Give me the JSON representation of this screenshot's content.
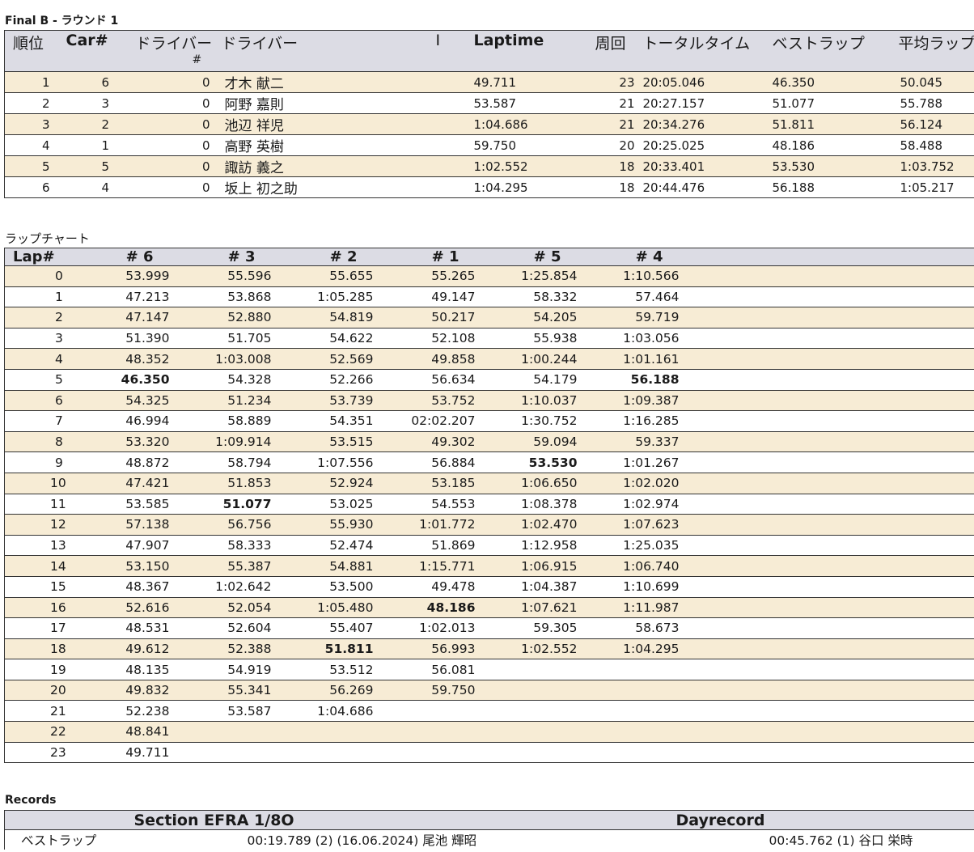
{
  "results_title": "Final B - ラウンド 1",
  "results": {
    "headers": {
      "pos": "順位",
      "car": "Car#",
      "driver_num": "ドライバー",
      "driver_num_sub": "#",
      "driver": "ドライバー",
      "sep": "I",
      "laptime": "Laptime",
      "laps": "周回",
      "total": "トータルタイム",
      "best": "ベストラップ",
      "avg": "平均ラップ"
    },
    "rows": [
      {
        "pos": "1",
        "car": "6",
        "dnum": "0",
        "driver": "才木 献二",
        "laptime": "49.711",
        "laps": "23",
        "total": "20:05.046",
        "best": "46.350",
        "avg": "50.045"
      },
      {
        "pos": "2",
        "car": "3",
        "dnum": "0",
        "driver": "阿野 嘉則",
        "laptime": "53.587",
        "laps": "21",
        "total": "20:27.157",
        "best": "51.077",
        "avg": "55.788"
      },
      {
        "pos": "3",
        "car": "2",
        "dnum": "0",
        "driver": "池辺 祥児",
        "laptime": "1:04.686",
        "laps": "21",
        "total": "20:34.276",
        "best": "51.811",
        "avg": "56.124"
      },
      {
        "pos": "4",
        "car": "1",
        "dnum": "0",
        "driver": "高野 英樹",
        "laptime": "59.750",
        "laps": "20",
        "total": "20:25.025",
        "best": "48.186",
        "avg": "58.488"
      },
      {
        "pos": "5",
        "car": "5",
        "dnum": "0",
        "driver": "諏訪 義之",
        "laptime": "1:02.552",
        "laps": "18",
        "total": "20:33.401",
        "best": "53.530",
        "avg": "1:03.752"
      },
      {
        "pos": "6",
        "car": "4",
        "dnum": "0",
        "driver": "坂上 初之助",
        "laptime": "1:04.295",
        "laps": "18",
        "total": "20:44.476",
        "best": "56.188",
        "avg": "1:05.217"
      }
    ]
  },
  "lapchart_title": "ラップチャート",
  "lapchart": {
    "headers": [
      "Lap#",
      "# 6",
      "# 3",
      "# 2",
      "# 1",
      "# 5",
      "# 4"
    ],
    "rows": [
      [
        "0",
        "53.999",
        "55.596",
        "55.655",
        "55.265",
        "1:25.854",
        "1:10.566"
      ],
      [
        "1",
        "47.213",
        "53.868",
        "1:05.285",
        "49.147",
        "58.332",
        "57.464"
      ],
      [
        "2",
        "47.147",
        "52.880",
        "54.819",
        "50.217",
        "54.205",
        "59.719"
      ],
      [
        "3",
        "51.390",
        "51.705",
        "54.622",
        "52.108",
        "55.938",
        "1:03.056"
      ],
      [
        "4",
        "48.352",
        "1:03.008",
        "52.569",
        "49.858",
        "1:00.244",
        "1:01.161"
      ],
      [
        "5",
        "46.350",
        "54.328",
        "52.266",
        "56.634",
        "54.179",
        "56.188"
      ],
      [
        "6",
        "54.325",
        "51.234",
        "53.739",
        "53.752",
        "1:10.037",
        "1:09.387"
      ],
      [
        "7",
        "46.994",
        "58.889",
        "54.351",
        "02:02.207",
        "1:30.752",
        "1:16.285"
      ],
      [
        "8",
        "53.320",
        "1:09.914",
        "53.515",
        "49.302",
        "59.094",
        "59.337"
      ],
      [
        "9",
        "48.872",
        "58.794",
        "1:07.556",
        "56.884",
        "53.530",
        "1:01.267"
      ],
      [
        "10",
        "47.421",
        "51.853",
        "52.924",
        "53.185",
        "1:06.650",
        "1:02.020"
      ],
      [
        "11",
        "53.585",
        "51.077",
        "53.025",
        "54.553",
        "1:08.378",
        "1:02.974"
      ],
      [
        "12",
        "57.138",
        "56.756",
        "55.930",
        "1:01.772",
        "1:02.470",
        "1:07.623"
      ],
      [
        "13",
        "47.907",
        "58.333",
        "52.474",
        "51.869",
        "1:12.958",
        "1:25.035"
      ],
      [
        "14",
        "53.150",
        "55.387",
        "54.881",
        "1:15.771",
        "1:06.915",
        "1:06.740"
      ],
      [
        "15",
        "48.367",
        "1:02.642",
        "53.500",
        "49.478",
        "1:04.387",
        "1:10.699"
      ],
      [
        "16",
        "52.616",
        "52.054",
        "1:05.480",
        "48.186",
        "1:07.621",
        "1:11.987"
      ],
      [
        "17",
        "48.531",
        "52.604",
        "55.407",
        "1:02.013",
        "59.305",
        "58.673"
      ],
      [
        "18",
        "49.612",
        "52.388",
        "51.811",
        "56.993",
        "1:02.552",
        "1:04.295"
      ],
      [
        "19",
        "48.135",
        "54.919",
        "53.512",
        "56.081",
        "",
        ""
      ],
      [
        "20",
        "49.832",
        "55.341",
        "56.269",
        "59.750",
        "",
        ""
      ],
      [
        "21",
        "52.238",
        "53.587",
        "1:04.686",
        "",
        "",
        ""
      ],
      [
        "22",
        "48.841",
        "",
        "",
        "",
        "",
        ""
      ],
      [
        "23",
        "49.711",
        "",
        "",
        "",
        "",
        ""
      ]
    ],
    "best": {
      "# 6": "5",
      "# 3": "11",
      "# 2": "18",
      "# 1": "16",
      "# 5": "9",
      "# 4": "5"
    }
  },
  "records_title": "Records",
  "records": {
    "section_header": "Section EFRA 1/8O",
    "day_header": "Dayrecord",
    "label": "ベストラップ",
    "section_value": "00:19.789 (2) (16.06.2024) 尾池 輝昭",
    "day_value": "00:45.762 (1) 谷口 栄時"
  }
}
